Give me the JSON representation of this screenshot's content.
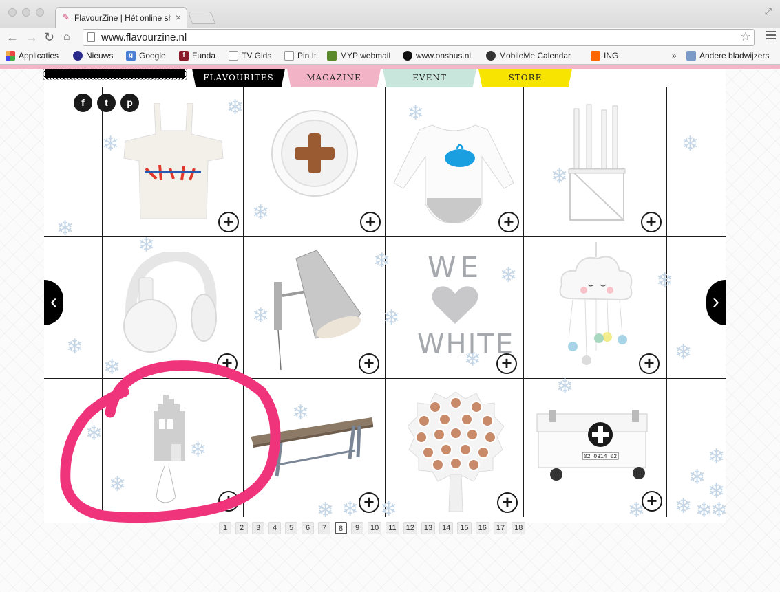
{
  "browser": {
    "tab_title": "FlavourZine | Hét online sh",
    "url": "www.flavourzine.nl",
    "bookmarks": [
      {
        "label": "Applicaties",
        "icon": "apps-grid-icon",
        "color": "#e44"
      },
      {
        "label": "Nieuws",
        "icon": "nieuws-icon",
        "color": "#2a2a8a"
      },
      {
        "label": "Google",
        "icon": "google-icon",
        "color": "#4a7fd4"
      },
      {
        "label": "Funda",
        "icon": "funda-icon",
        "color": "#8a1a2a"
      },
      {
        "label": "TV Gids",
        "icon": "document-icon",
        "color": "#888"
      },
      {
        "label": "Pin It",
        "icon": "document-icon",
        "color": "#888"
      },
      {
        "label": "MYP webmail",
        "icon": "webmail-icon",
        "color": "#5a8a2a"
      },
      {
        "label": "www.onshus.nl",
        "icon": "onshus-icon",
        "color": "#111"
      },
      {
        "label": "MobileMe Calendar",
        "icon": "apple-icon",
        "color": "#333"
      },
      {
        "label": "ING",
        "icon": "ing-lion-icon",
        "color": "#f60"
      },
      {
        "label": "»",
        "icon": "",
        "color": "#333"
      },
      {
        "label": "Andere bladwijzers",
        "icon": "folder-icon",
        "color": "#7a9ac8"
      }
    ]
  },
  "site": {
    "nav": [
      {
        "label": "FLAVOURITES",
        "bg": "#000000",
        "color": "#ffffff"
      },
      {
        "label": "MAGAZINE",
        "bg": "#f2b3c6",
        "color": "#222222"
      },
      {
        "label": "EVENT",
        "bg": "#c8e6dc",
        "color": "#222222"
      },
      {
        "label": "STORE",
        "bg": "#f7e400",
        "color": "#222222"
      }
    ],
    "social": [
      {
        "label": "f",
        "icon": "facebook-icon"
      },
      {
        "label": "t",
        "icon": "twitter-icon"
      },
      {
        "label": "p",
        "icon": "pinterest-icon"
      }
    ],
    "we_white": {
      "line1": "WE",
      "line2": "WHITE"
    },
    "crate_label": "02 0314 02",
    "pagination": [
      "1",
      "2",
      "3",
      "4",
      "5",
      "6",
      "7",
      "8",
      "9",
      "10",
      "11",
      "12",
      "13",
      "14",
      "15",
      "16",
      "17",
      "18"
    ],
    "current_page": "8"
  }
}
